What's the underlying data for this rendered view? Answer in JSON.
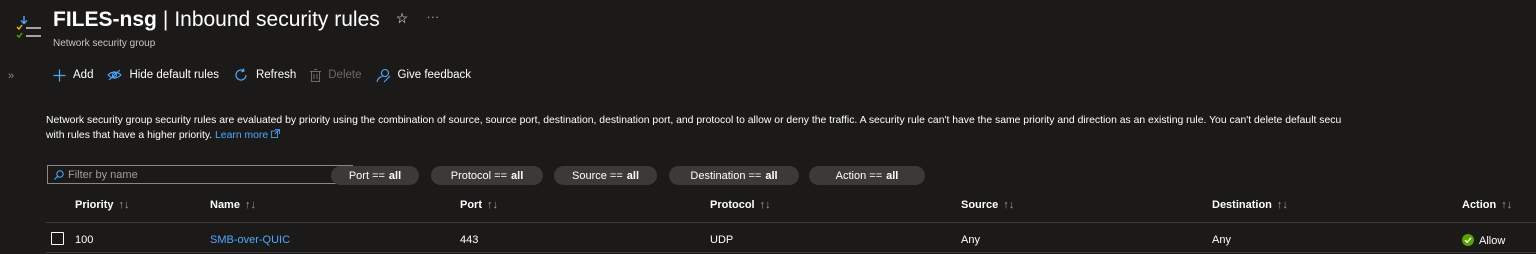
{
  "header": {
    "resource_name": "FILES-nsg",
    "separator": "|",
    "page_name": "Inbound security rules",
    "subtitle": "Network security group",
    "star_glyph": "☆",
    "more_glyph": "···"
  },
  "sidebar": {
    "expand_glyph": "»"
  },
  "toolbar": {
    "add_label": "Add",
    "hide_default_label": "Hide default rules",
    "refresh_label": "Refresh",
    "delete_label": "Delete",
    "feedback_label": "Give feedback"
  },
  "description": {
    "text": "Network security group security rules are evaluated by priority using the combination of source, source port, destination, destination port, and protocol to allow or deny the traffic. A security rule can't have the same priority and direction as an existing rule. You can't delete default secu",
    "text_line2": "with rules that have a higher priority.",
    "learn_more": "Learn more"
  },
  "filters": {
    "search_placeholder": "Filter by name",
    "pills": [
      {
        "label": "Port ==",
        "value": "all"
      },
      {
        "label": "Protocol ==",
        "value": "all"
      },
      {
        "label": "Source ==",
        "value": "all"
      },
      {
        "label": "Destination ==",
        "value": "all"
      },
      {
        "label": "Action ==",
        "value": "all"
      }
    ]
  },
  "table": {
    "sort_glyph": "↑↓",
    "columns": [
      "Priority",
      "Name",
      "Port",
      "Protocol",
      "Source",
      "Destination",
      "Action"
    ],
    "rows": [
      {
        "priority": "100",
        "name": "SMB-over-QUIC",
        "port": "443",
        "protocol": "UDP",
        "source": "Any",
        "destination": "Any",
        "action": "Allow"
      }
    ]
  },
  "colors": {
    "background": "#1b1a19",
    "accent": "#4fa9ff",
    "allow_green": "#57a300",
    "pill_bg": "#3b3a39"
  }
}
